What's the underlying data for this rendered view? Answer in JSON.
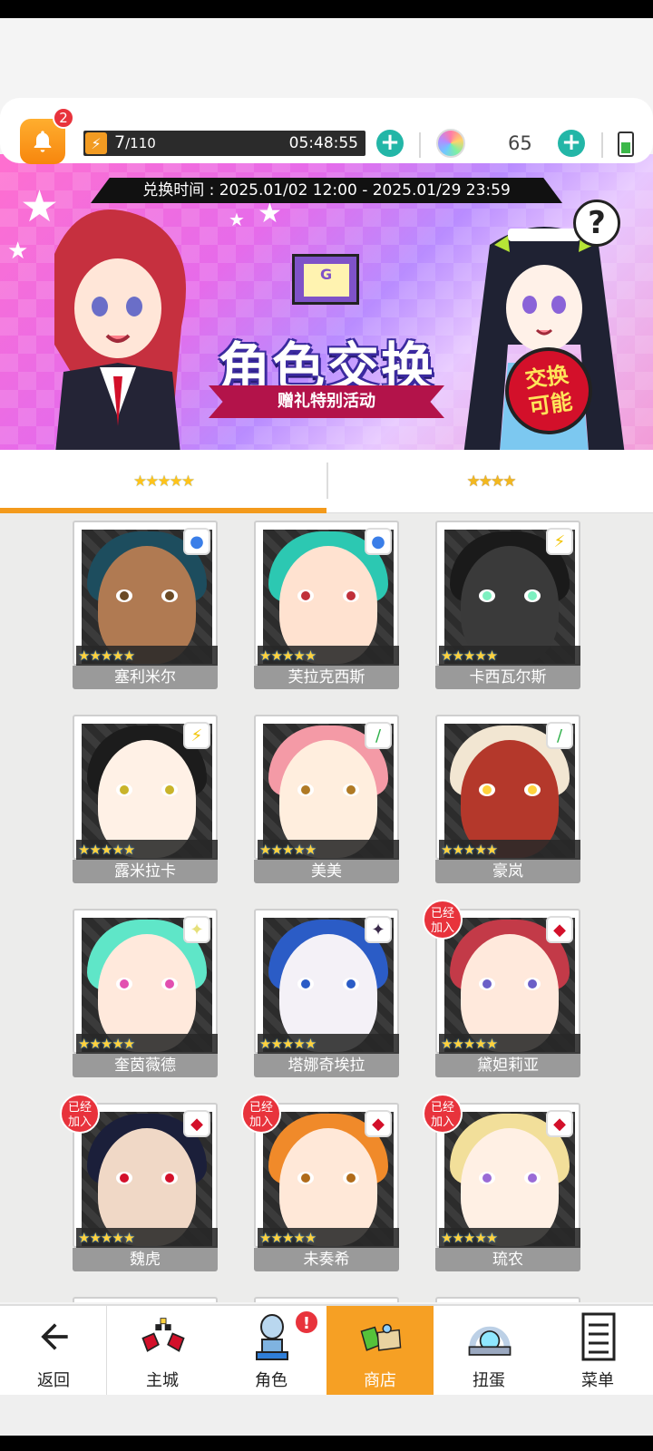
{
  "topbar": {
    "notification_count": "2",
    "stamina_current": "7",
    "stamina_max": "/110",
    "stamina_timer": "05:48:55",
    "gem_count": "65"
  },
  "banner": {
    "exchange_period": "兑换时间 : 2025.01/02 12:00 - 2025.01/29 23:59",
    "title": "角色交换",
    "subtitle": "赠礼特别活动",
    "seal_line1": "交换",
    "seal_line2": "可能",
    "help": "?"
  },
  "tabs": [
    {
      "label": "★★★★★",
      "active": true
    },
    {
      "label": "★★★★",
      "active": false
    }
  ],
  "characters": [
    {
      "name": "塞利米尔",
      "stars": "★★★★★",
      "element": "●",
      "element_color": "#3a7ee8",
      "joined": false,
      "hair": "#1d4d5e",
      "skin": "#b07a52",
      "iris": "#6a4a25"
    },
    {
      "name": "芙拉克西斯",
      "stars": "★★★★★",
      "element": "●",
      "element_color": "#3a7ee8",
      "joined": false,
      "hair": "#2cc8b2",
      "skin": "#ffe2d0",
      "iris": "#c0303a"
    },
    {
      "name": "卡西瓦尔斯",
      "stars": "★★★★★",
      "element": "⚡",
      "element_color": "#f2c400",
      "joined": false,
      "hair": "#1a1a1a",
      "skin": "#3a3a3a",
      "iris": "#7df0c0"
    },
    {
      "name": "露米拉卡",
      "stars": "★★★★★",
      "element": "⚡",
      "element_color": "#f2c400",
      "joined": false,
      "hair": "#1c1c1c",
      "skin": "#fff1e6",
      "iris": "#c9b42a"
    },
    {
      "name": "美美",
      "stars": "★★★★★",
      "element": "/",
      "element_color": "#2fb04a",
      "joined": false,
      "hair": "#f49aa6",
      "skin": "#ffeede",
      "iris": "#b07a25"
    },
    {
      "name": "豪岚",
      "stars": "★★★★★",
      "element": "/",
      "element_color": "#2fb04a",
      "joined": false,
      "hair": "#f2e6d2",
      "skin": "#b4382b",
      "iris": "#ffd23e"
    },
    {
      "name": "奎茵薇德",
      "stars": "★★★★★",
      "element": "✦",
      "element_color": "#e6e07a",
      "joined": false,
      "hair": "#5fe6c8",
      "skin": "#ffe9dc",
      "iris": "#e24fb0"
    },
    {
      "name": "塔娜奇埃拉",
      "stars": "★★★★★",
      "element": "✦",
      "element_color": "#3a2a4a",
      "joined": false,
      "hair": "#2b5cc6",
      "skin": "#f4f1f7",
      "iris": "#2b5cc6"
    },
    {
      "name": "黛妲莉亚",
      "stars": "★★★★★",
      "element": "◆",
      "element_color": "#d3102a",
      "joined": true,
      "hair": "#c33a48",
      "skin": "#ffe9dc",
      "iris": "#6b5fc7"
    },
    {
      "name": "魏虎",
      "stars": "★★★★★",
      "element": "◆",
      "element_color": "#d3102a",
      "joined": true,
      "hair": "#1b1f3a",
      "skin": "#f0d8c6",
      "iris": "#d3102a"
    },
    {
      "name": "未奏希",
      "stars": "★★★★★",
      "element": "◆",
      "element_color": "#d3102a",
      "joined": true,
      "hair": "#f08a2a",
      "skin": "#ffe8d8",
      "iris": "#b06b1a"
    },
    {
      "name": "琉农",
      "stars": "★★★★★",
      "element": "◆",
      "element_color": "#d3102a",
      "joined": true,
      "hair": "#f2df9a",
      "skin": "#fff0e4",
      "iris": "#9a6bd6"
    }
  ],
  "joined_label_1": "已经",
  "joined_label_2": "加入",
  "nav": {
    "back": "返回",
    "town": "主城",
    "character": "角色",
    "shop": "商店",
    "gacha": "扭蛋",
    "menu": "菜单",
    "alert": "!"
  }
}
